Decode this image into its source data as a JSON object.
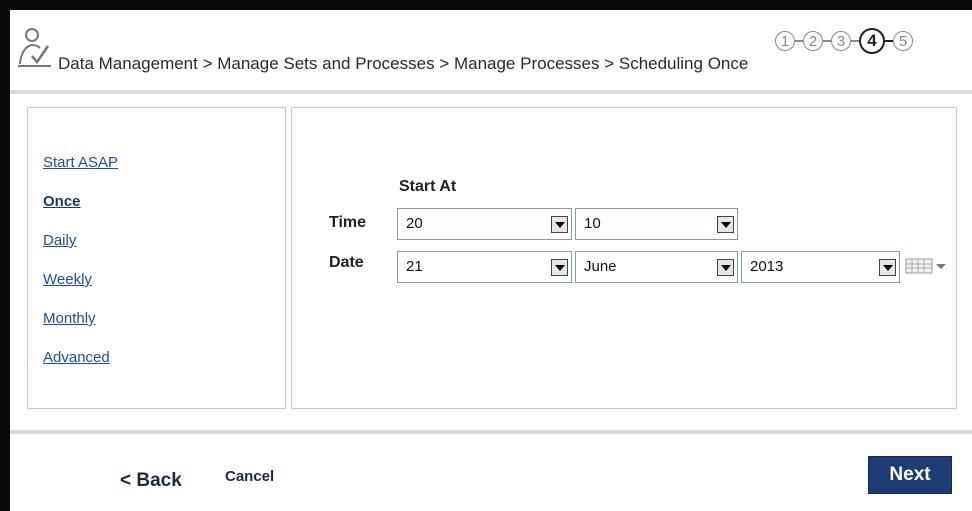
{
  "header": {
    "breadcrumb": "Data Management > Manage Sets and Processes > Manage Processes > Scheduling Once",
    "steps": [
      "1",
      "2",
      "3",
      "4",
      "5"
    ],
    "active_step": 4
  },
  "sidebar": {
    "items": [
      {
        "label": "Start ASAP"
      },
      {
        "label": "Once"
      },
      {
        "label": "Daily"
      },
      {
        "label": "Weekly"
      },
      {
        "label": "Monthly"
      },
      {
        "label": "Advanced"
      }
    ],
    "selected": "Once"
  },
  "form": {
    "section_title": "Start At",
    "time_label": "Time",
    "date_label": "Date",
    "time_hour": "20",
    "time_minute": "10",
    "date_day": "21",
    "date_month": "June",
    "date_year": "2013"
  },
  "footer": {
    "back_label": "< Back",
    "cancel_label": "Cancel",
    "next_label": "Next"
  },
  "colors": {
    "link": "#1a4fa3",
    "next_button": "#1b3d73",
    "frame": "#0a0a0a"
  },
  "icons": [
    "user-check-icon",
    "calendar-icon",
    "chevron-down-icon"
  ]
}
